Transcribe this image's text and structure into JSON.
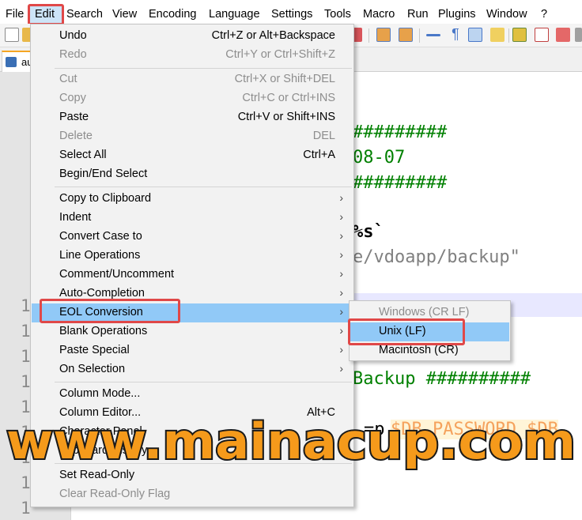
{
  "menubar": {
    "items": [
      "File",
      "Edit",
      "Search",
      "View",
      "Encoding",
      "Language",
      "Settings",
      "Tools",
      "Macro",
      "Run",
      "Plugins",
      "Window",
      "?"
    ]
  },
  "tab": {
    "label": "au"
  },
  "editor": {
    "line_numbers": [
      "1",
      "1",
      "1",
      "1",
      "1",
      "1",
      "1",
      "1",
      "1",
      "1"
    ],
    "code_lines": [
      "#########",
      "08-07",
      "#########",
      "%s`",
      "e/vdoapp/backup\"",
      "Backup ##########",
      "=p",
      "$DB_PASSWORD $DB"
    ]
  },
  "edit_menu": {
    "groups": [
      [
        {
          "label": "Undo",
          "shortcut": "Ctrl+Z or Alt+Backspace",
          "enabled": true
        },
        {
          "label": "Redo",
          "shortcut": "Ctrl+Y or Ctrl+Shift+Z",
          "enabled": false
        }
      ],
      [
        {
          "label": "Cut",
          "shortcut": "Ctrl+X or Shift+DEL",
          "enabled": false
        },
        {
          "label": "Copy",
          "shortcut": "Ctrl+C or Ctrl+INS",
          "enabled": false
        },
        {
          "label": "Paste",
          "shortcut": "Ctrl+V or Shift+INS",
          "enabled": true
        },
        {
          "label": "Delete",
          "shortcut": "DEL",
          "enabled": false
        },
        {
          "label": "Select All",
          "shortcut": "Ctrl+A",
          "enabled": true
        },
        {
          "label": "Begin/End Select",
          "shortcut": "",
          "enabled": true
        }
      ],
      [
        {
          "label": "Copy to Clipboard",
          "submenu": true
        },
        {
          "label": "Indent",
          "submenu": true
        },
        {
          "label": "Convert Case to",
          "submenu": true
        },
        {
          "label": "Line Operations",
          "submenu": true
        },
        {
          "label": "Comment/Uncomment",
          "submenu": true
        },
        {
          "label": "Auto-Completion",
          "submenu": true
        },
        {
          "label": "EOL Conversion",
          "submenu": true,
          "active": true
        },
        {
          "label": "Blank Operations",
          "submenu": true
        },
        {
          "label": "Paste Special",
          "submenu": true
        },
        {
          "label": "On Selection",
          "submenu": true
        }
      ],
      [
        {
          "label": "Column Mode...",
          "shortcut": ""
        },
        {
          "label": "Column Editor...",
          "shortcut": "Alt+C"
        },
        {
          "label": "Character Panel",
          "shortcut": ""
        },
        {
          "label": "Clipboard History",
          "shortcut": ""
        }
      ],
      [
        {
          "label": "Set Read-Only",
          "enabled": true
        },
        {
          "label": "Clear Read-Only Flag",
          "enabled": false
        }
      ]
    ]
  },
  "eol_submenu": {
    "items": [
      {
        "label": "Windows (CR LF)",
        "enabled": false
      },
      {
        "label": "Unix (LF)",
        "enabled": true,
        "active": true
      },
      {
        "label": "Macintosh (CR)",
        "enabled": true
      }
    ]
  },
  "watermark": {
    "text": "www.mainacup.com"
  },
  "colors": {
    "menu_bg": "#f2f2f2",
    "menu_highlight": "#91c9f7",
    "annotation_red": "#e04848",
    "watermark_fill": "#f59a1b",
    "code_green": "#008000",
    "code_gray": "#808080",
    "code_orange": "#f5a25c"
  }
}
